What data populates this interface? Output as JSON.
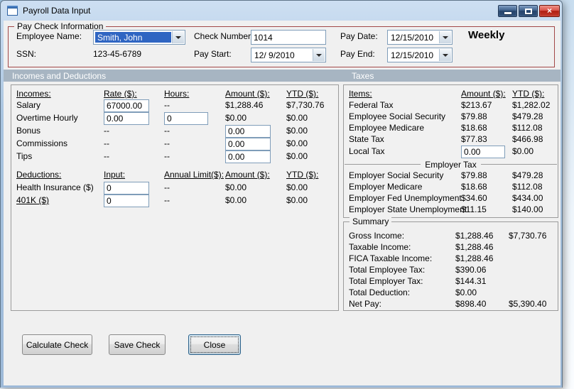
{
  "window": {
    "title": "Payroll Data Input",
    "close_glyph": "×"
  },
  "pay_check_info": {
    "legend": "Pay Check Information",
    "pay_frequency": "Weekly",
    "fields": {
      "employee_name": {
        "label": "Employee Name:",
        "value": "Smith, John"
      },
      "ssn": {
        "label": "SSN:",
        "value": "123-45-6789"
      },
      "check_number": {
        "label": "Check Number:",
        "value": "1014"
      },
      "pay_start": {
        "label": "Pay Start:",
        "value": "12/ 9/2010"
      },
      "pay_date": {
        "label": "Pay Date:",
        "value": "12/15/2010"
      },
      "pay_end": {
        "label": "Pay End:",
        "value": "12/15/2010"
      }
    }
  },
  "section_headers": {
    "incomes_deductions": "Incomes and Deductions",
    "taxes": "Taxes"
  },
  "incomes": {
    "headers": {
      "name": "Incomes:",
      "rate": "Rate ($):",
      "hours": "Hours:",
      "amount": "Amount ($):",
      "ytd": "YTD ($):"
    },
    "salary": {
      "name": "Salary",
      "rate": "67000.00",
      "hours": "--",
      "amount": "$1,288.46",
      "ytd": "$7,730.76"
    },
    "overtime": {
      "name": "Overtime Hourly",
      "rate": "0.00",
      "hours": "0",
      "amount": "$0.00",
      "ytd": "$0.00"
    },
    "bonus": {
      "name": "Bonus",
      "rate": "--",
      "hours": "--",
      "amount": "0.00",
      "ytd": "$0.00"
    },
    "commissions": {
      "name": "Commissions",
      "rate": "--",
      "hours": "--",
      "amount": "0.00",
      "ytd": "$0.00"
    },
    "tips": {
      "name": "Tips",
      "rate": "--",
      "hours": "--",
      "amount": "0.00",
      "ytd": "$0.00"
    }
  },
  "deductions": {
    "headers": {
      "name": "Deductions:",
      "input": "Input:",
      "annual_limit": "Annual Limit($):",
      "amount": "Amount ($):",
      "ytd": "YTD ($):"
    },
    "health_insurance": {
      "name": "Health Insurance  ($)",
      "input": "0",
      "annual_limit": "--",
      "amount": "$0.00",
      "ytd": "$0.00"
    },
    "k401": {
      "name": "401K  ($)",
      "input": "0",
      "annual_limit": "--",
      "amount": "$0.00",
      "ytd": "$0.00"
    }
  },
  "taxes": {
    "headers": {
      "item": "Items:",
      "amount": "Amount ($):",
      "ytd": "YTD ($):"
    },
    "rows": [
      {
        "item": "Federal Tax",
        "amount": "$213.67",
        "ytd": "$1,282.02"
      },
      {
        "item": "Employee Social Security",
        "amount": "$79.88",
        "ytd": "$479.28"
      },
      {
        "item": "Employee Medicare",
        "amount": "$18.68",
        "ytd": "$112.08"
      },
      {
        "item": "State Tax",
        "amount": "$77.83",
        "ytd": "$466.98"
      }
    ],
    "local_tax": {
      "item": "Local Tax",
      "amount": "0.00",
      "ytd": "$0.00"
    },
    "employer_section_label": "Employer Tax",
    "employer_rows": [
      {
        "item": "Employer Social Security",
        "amount": "$79.88",
        "ytd": "$479.28"
      },
      {
        "item": "Employer Medicare",
        "amount": "$18.68",
        "ytd": "$112.08"
      },
      {
        "item": "Employer Fed Unemployment",
        "amount": "$34.60",
        "ytd": "$434.00"
      },
      {
        "item": "Employer State Unemployment",
        "amount": "$11.15",
        "ytd": "$140.00"
      }
    ]
  },
  "summary": {
    "legend": "Summary",
    "rows": [
      {
        "label": "Gross Income:",
        "value": "$1,288.46",
        "ytd": "$7,730.76"
      },
      {
        "label": "Taxable Income:",
        "value": "$1,288.46",
        "ytd": ""
      },
      {
        "label": "FICA Taxable Income:",
        "value": "$1,288.46",
        "ytd": ""
      },
      {
        "label": "Total Employee Tax:",
        "value": "$390.06",
        "ytd": ""
      },
      {
        "label": "Total Employer Tax:",
        "value": "$144.31",
        "ytd": ""
      },
      {
        "label": "Total Deduction:",
        "value": "$0.00",
        "ytd": ""
      },
      {
        "label": "Net Pay:",
        "value": "$898.40",
        "ytd": "$5,390.40"
      }
    ]
  },
  "action_buttons": {
    "calculate": "Calculate Check",
    "save": "Save Check",
    "close": "Close"
  },
  "colors": {
    "paycheck_groupbox_border": "#a24747",
    "section_band": "#a7b5c2",
    "combo_selection": "#2f65c2",
    "close_button_red": "#b01e10"
  }
}
